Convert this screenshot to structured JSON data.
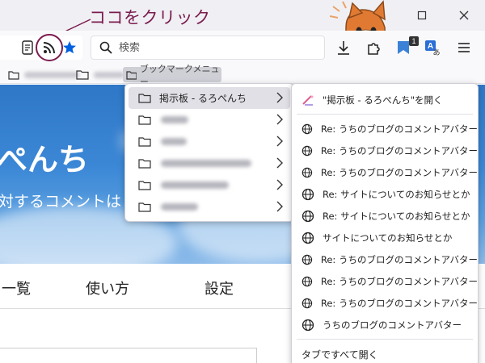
{
  "annotation": {
    "text": "ココをクリック",
    "color": "#7b1b4f"
  },
  "window": {
    "minimize_icon": "minimize-icon",
    "maximize_icon": "maximize-icon",
    "close_icon": "close-icon"
  },
  "toolbar": {
    "search_placeholder": "検索",
    "extension_badge": "1",
    "reader_icon": "reader-view-icon",
    "rss_icon": "rss-icon",
    "bookmark_star_icon": "star-icon",
    "download_icon": "download-icon",
    "extensions_icon": "puzzle-icon",
    "menu_icon": "hamburger-icon",
    "accent": "#0060df"
  },
  "bookmarks_bar": {
    "active_folder": "ブックマークメニュー"
  },
  "page": {
    "hero_title": "ぺんち",
    "hero_subtitle": "対するコメントは",
    "nav": [
      "一覧",
      "使い方",
      "設定"
    ]
  },
  "menu1": {
    "items": [
      {
        "label": "掲示板 - るろぺんち",
        "highlighted": true
      }
    ]
  },
  "menu2": {
    "open_feed": "\"掲示板 - るろぺんち\"を開く",
    "items": [
      "Re: うちのブログのコメントアバター",
      "Re: うちのブログのコメントアバター",
      "Re: うちのブログのコメントアバター",
      "Re: サイトについてのお知らせとか",
      "Re: サイトについてのお知らせとか",
      "サイトについてのお知らせとか",
      "Re: うちのブログのコメントアバター",
      "Re: うちのブログのコメントアバター",
      "Re: うちのブログのコメントアバター",
      "うちのブログのコメントアバター"
    ],
    "open_all": "タブですべて開く"
  }
}
